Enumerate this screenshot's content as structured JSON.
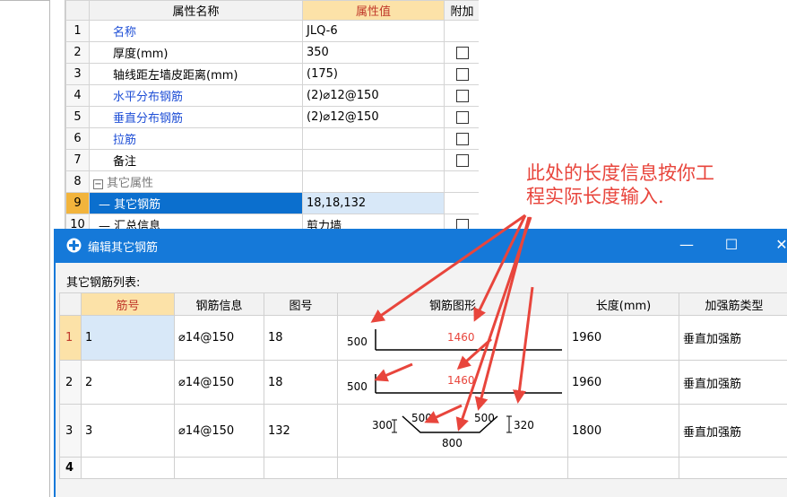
{
  "properties": {
    "headers": {
      "index": "",
      "name": "属性名称",
      "value": "属性值",
      "extra": "附加"
    },
    "rows": [
      {
        "no": "1",
        "name": "名称",
        "value": "JLQ-6"
      },
      {
        "no": "2",
        "name": "厚度(mm)",
        "value": "350"
      },
      {
        "no": "3",
        "name": "轴线距左墙皮距离(mm)",
        "value": "(175)"
      },
      {
        "no": "4",
        "name": "水平分布钢筋",
        "value": "(2)⌀12@150"
      },
      {
        "no": "5",
        "name": "垂直分布钢筋",
        "value": "(2)⌀12@150"
      },
      {
        "no": "6",
        "name": "拉筋",
        "value": ""
      },
      {
        "no": "7",
        "name": "备注",
        "value": ""
      },
      {
        "no": "8",
        "name": "其它属性",
        "value": ""
      },
      {
        "no": "9",
        "name": "其它钢筋",
        "value": "18,18,132"
      },
      {
        "no": "10",
        "name": "汇总信息",
        "value": "剪力墙"
      }
    ],
    "expander": "−"
  },
  "annotation": {
    "line1": "此处的长度信息按你工",
    "line2": "程实际长度输入."
  },
  "dialog": {
    "title": "编辑其它钢筋",
    "controls": {
      "minimize": "—",
      "maximize": "☐",
      "close": "✕"
    },
    "list_label": "其它钢筋列表:",
    "headers": [
      "",
      "筋号",
      "钢筋信息",
      "图号",
      "钢筋图形",
      "长度(mm)",
      "加强筋类型"
    ],
    "rows": [
      {
        "no": "1",
        "bar_no": "1",
        "info": "⌀14@150",
        "fig": "18",
        "length": "1960",
        "type": "垂直加强筋"
      },
      {
        "no": "2",
        "bar_no": "2",
        "info": "⌀14@150",
        "fig": "18",
        "length": "1960",
        "type": "垂直加强筋"
      },
      {
        "no": "3",
        "bar_no": "3",
        "info": "⌀14@150",
        "fig": "132",
        "length": "1800",
        "type": "垂直加强筋"
      },
      {
        "no": "4",
        "bar_no": "",
        "info": "",
        "fig": "",
        "length": "",
        "type": ""
      }
    ],
    "shapes": {
      "s18_a": {
        "left": "500",
        "top": "1460"
      },
      "s18_b": {
        "left": "500",
        "top": "1460"
      },
      "s132": {
        "h1": "300",
        "s1": "500",
        "s2": "500",
        "h2": "320",
        "bottom": "800"
      }
    }
  },
  "colors": {
    "accent": "#1579d9",
    "annotation": "#e8453c",
    "link": "#1f4fd6",
    "header_highlight": "#fce2a8"
  }
}
